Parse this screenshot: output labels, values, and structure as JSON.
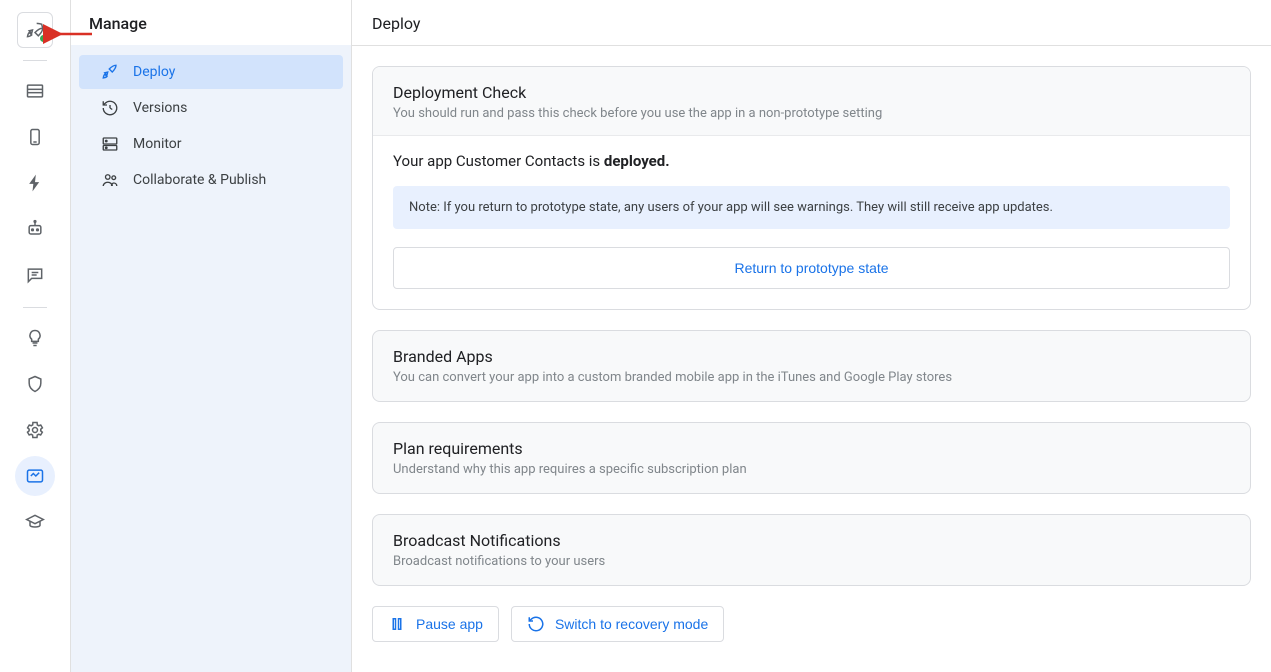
{
  "sidebar": {
    "title": "Manage",
    "items": [
      {
        "label": "Deploy"
      },
      {
        "label": "Versions"
      },
      {
        "label": "Monitor"
      },
      {
        "label": "Collaborate & Publish"
      }
    ]
  },
  "main": {
    "title": "Deploy",
    "deployment_check": {
      "title": "Deployment Check",
      "subtitle": "You should run and pass this check before you use the app in a non-prototype setting",
      "status_prefix": "Your app Customer Contacts is ",
      "status_bold": "deployed.",
      "note": "Note: If you return to prototype state, any users of your app will see warnings. They will still receive app updates.",
      "return_button": "Return to prototype state"
    },
    "branded": {
      "title": "Branded Apps",
      "subtitle": "You can convert your app into a custom branded mobile app in the iTunes and Google Play stores"
    },
    "plan": {
      "title": "Plan requirements",
      "subtitle": "Understand why this app requires a specific subscription plan"
    },
    "broadcast": {
      "title": "Broadcast Notifications",
      "subtitle": "Broadcast notifications to your users"
    },
    "actions": {
      "pause": "Pause app",
      "recovery": "Switch to recovery mode"
    }
  }
}
